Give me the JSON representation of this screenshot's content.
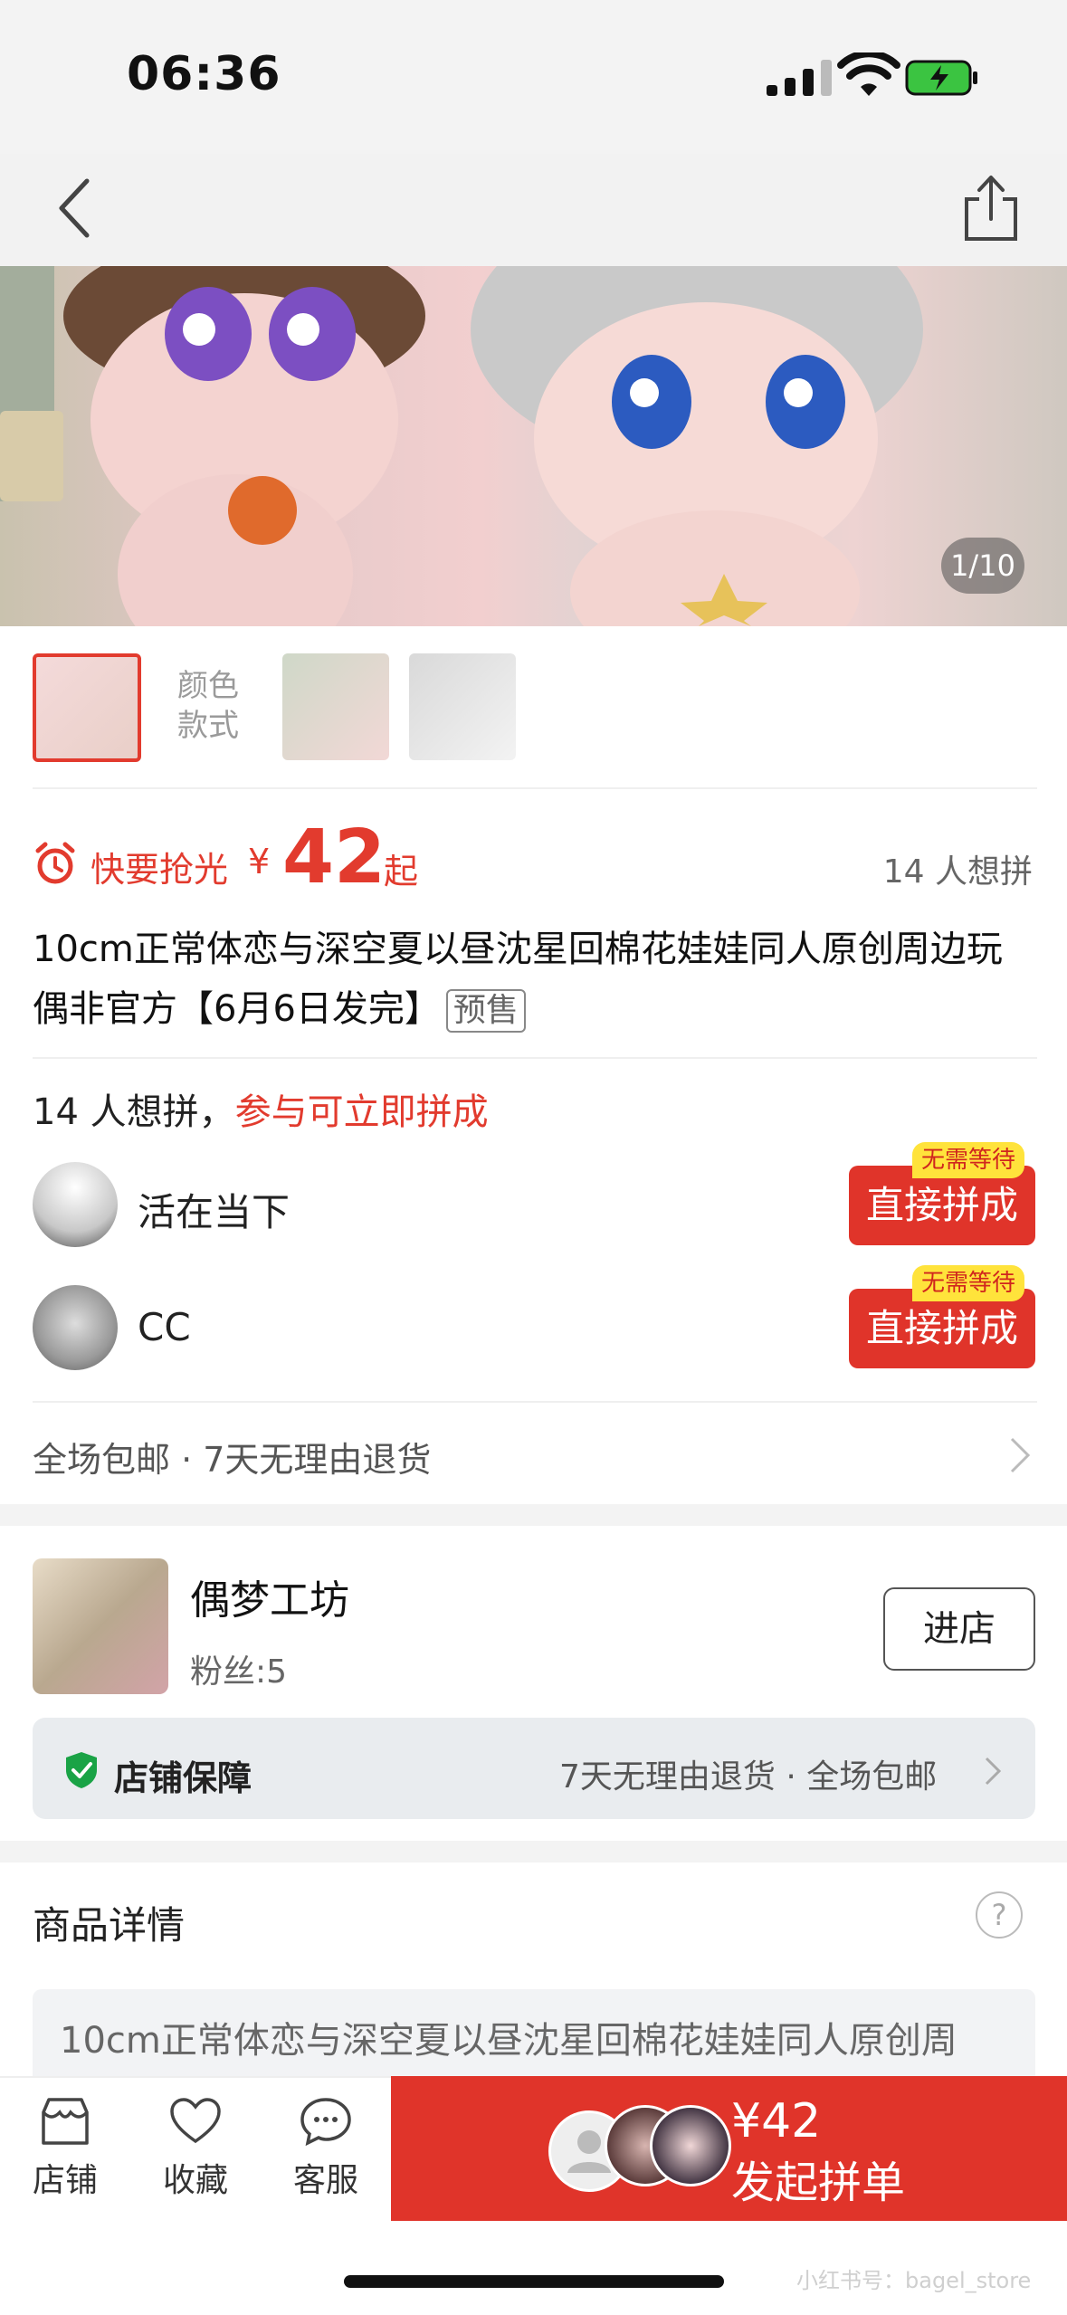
{
  "status": {
    "time": "06:36"
  },
  "gallery": {
    "pager": "1/10"
  },
  "variants": {
    "label": "颜色款式"
  },
  "price": {
    "hurry_label": "快要抢光",
    "currency": "¥",
    "amount": "42",
    "suffix": "起",
    "wants": "14 人想拼"
  },
  "product": {
    "title": "10cm正常体恋与深空夏以昼沈星回棉花娃娃同人原创周边玩偶非官方【6月6日发完】",
    "badge": "预售"
  },
  "group_buy": {
    "head_count": "14 人想拼，",
    "head_cta": "参与可立即拼成",
    "members": [
      {
        "name": "活在当下",
        "tag": "无需等待",
        "button": "直接拼成"
      },
      {
        "name": "CC",
        "tag": "无需等待",
        "button": "直接拼成"
      }
    ]
  },
  "shipping": {
    "text": "全场包邮 · 7天无理由退货"
  },
  "shop": {
    "name": "偶梦工坊",
    "fans": "粉丝:5",
    "enter": "进店",
    "guarantee_title": "店铺保障",
    "guarantee_text": "7天无理由退货 · 全场包邮"
  },
  "details": {
    "title": "商品详情",
    "help": "?",
    "desc": "10cm正常体恋与深空夏以昼沈星回棉花娃娃同人原创周"
  },
  "bottom": {
    "tabs": [
      "店铺",
      "收藏",
      "客服"
    ],
    "cta_price": "¥42",
    "cta_label": "发起拼单"
  },
  "watermark": "小红书号：bagel_store",
  "colors": {
    "accent": "#e0342a",
    "tag_yellow": "#ffe33b"
  }
}
